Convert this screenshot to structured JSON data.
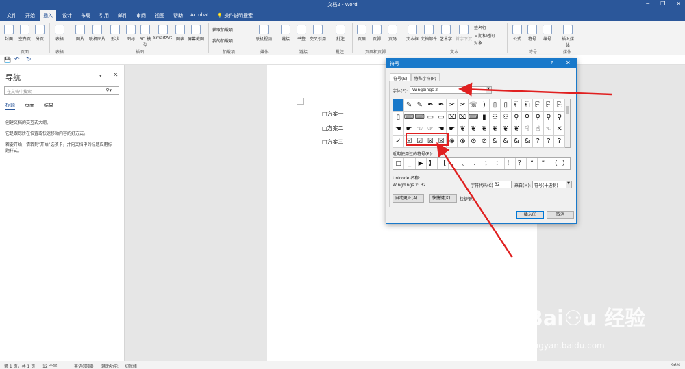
{
  "window": {
    "title": "文档2 - Word",
    "minimize": "─",
    "restore": "❐",
    "close": "✕"
  },
  "tabs": [
    "文件",
    "开始",
    "插入",
    "设计",
    "布局",
    "引用",
    "邮件",
    "审阅",
    "视图",
    "帮助",
    "Acrobat"
  ],
  "active_tab": "插入",
  "tell_me": "操作说明搜索",
  "ribbon": {
    "buttons": [
      "封面",
      "空白页",
      "分页",
      "表格",
      "图片",
      "联机图片",
      "形状",
      "图标",
      "3D 模型",
      "SmartArt",
      "图表",
      "屏幕截图",
      "获取加载项",
      "我的加载项",
      "联机视频",
      "链接",
      "书签",
      "交叉引用",
      "批注",
      "页眉",
      "页脚",
      "页码",
      "文本框",
      "文档部件",
      "艺术字",
      "首字下沉",
      "签名行",
      "日期和时间",
      "对象",
      "公式",
      "符号",
      "编号",
      "插入媒体"
    ],
    "groups": [
      "页面",
      "表格",
      "插图",
      "加载项",
      "媒体",
      "链接",
      "批注",
      "页眉和页脚",
      "文本",
      "符号",
      "媒体"
    ]
  },
  "nav": {
    "title": "导航",
    "search_placeholder": "在文档中搜索",
    "tabs": [
      "标题",
      "页面",
      "结果"
    ],
    "lines": [
      "创建文档的交互式大纲。",
      "它是跟踪所在位置或快速移动内容的好方式。",
      "若要开始，请转到\"开始\"选项卡，并向文档中的标题应用标",
      "题样式。"
    ]
  },
  "doc": {
    "lines": [
      "□方案一",
      "□方案二",
      "□方案三"
    ]
  },
  "dialog": {
    "title": "符号",
    "help": "?",
    "close": "✕",
    "tabs": [
      "符号(S)",
      "特殊字符(P)"
    ],
    "font_label": "字体(F):",
    "font_value": "Wingdings 2",
    "symbols": [
      "",
      "✎",
      "✎",
      "✒",
      "✒",
      "✂",
      "✂",
      "☏",
      ")",
      "▯",
      "▯",
      "⎗",
      "⎗",
      "⎘",
      "⎘",
      "⎘",
      "▯",
      "⌨",
      "⌨",
      "▭",
      "▭",
      "⌧",
      "⌧",
      "⌨",
      "▮",
      "⚇",
      "⚇",
      "⚲",
      "⚲",
      "⚲",
      "⚲",
      "⚲",
      "☚",
      "☛",
      "☜",
      "☞",
      "☚",
      "☛",
      "❦",
      "❦",
      "❦",
      "❦",
      "❦",
      "❦",
      "☟",
      "☝",
      "☜",
      "✕",
      "✓",
      "☒",
      "☑",
      "☒",
      "☒",
      "⊗",
      "⊗",
      "⊘",
      "⊘",
      "&",
      "&",
      "&",
      "&",
      "?",
      "?",
      "?"
    ],
    "recent_label": "近期使用过的符号(R):",
    "recent": [
      "□",
      "_",
      "▶",
      "】",
      "【",
      "，",
      "。",
      "、",
      "；",
      "：",
      "！",
      "？",
      "“",
      "”",
      "（",
      "）"
    ],
    "unicode_label": "Unicode 名称:",
    "unicode_value": "Wingdings 2: 32",
    "code_label": "字符代码(C):",
    "code_value": "32",
    "from_label": "来自(M):",
    "from_value": "符号(十进制)",
    "autocorrect": "自动更正(A)...",
    "shortcut_btn": "快捷键(K)...",
    "shortcut_text": "快捷键:",
    "insert": "插入(I)",
    "cancel": "取消"
  },
  "status": {
    "page": "第 1 页，共 1 页",
    "words": "12 个字",
    "lang": "英语(美国)",
    "access": "辅助功能: 一切就绪",
    "zoom": "96%"
  },
  "watermark": {
    "brand": "Bai⚇u 经验",
    "url": "jingyan.baidu.com"
  },
  "colors": {
    "brand": "#2b579a",
    "dialog_accent": "#1979ca",
    "annotation": "#e02020"
  }
}
